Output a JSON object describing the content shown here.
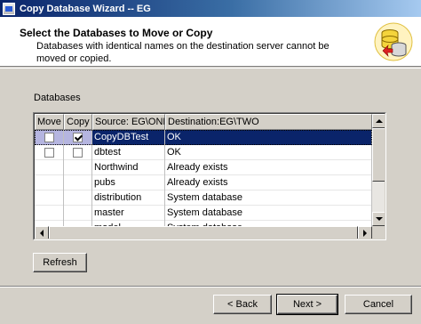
{
  "window": {
    "title": "Copy Database Wizard  -- EG"
  },
  "header": {
    "title": "Select the Databases to Move or Copy",
    "description": "Databases with identical names on the destination server cannot be moved or copied.",
    "icon": "database-copy-icon"
  },
  "databases_label": "Databases",
  "grid": {
    "columns": [
      "Move",
      "Copy",
      "Source: EG\\ONE",
      "Destination:EG\\TWO"
    ],
    "rows": [
      {
        "move": false,
        "copy": true,
        "source": "CopyDBTest",
        "destination": "OK",
        "selected": true,
        "has_checkboxes": true
      },
      {
        "move": false,
        "copy": false,
        "source": "dbtest",
        "destination": "OK",
        "selected": false,
        "has_checkboxes": true
      },
      {
        "source": "Northwind",
        "destination": "Already exists",
        "has_checkboxes": false
      },
      {
        "source": "pubs",
        "destination": "Already exists",
        "has_checkboxes": false
      },
      {
        "source": "distribution",
        "destination": "System database",
        "has_checkboxes": false
      },
      {
        "source": "master",
        "destination": "System database",
        "has_checkboxes": false
      },
      {
        "source": "model",
        "destination": "System database",
        "has_checkboxes": false
      }
    ]
  },
  "buttons": {
    "refresh": "Refresh",
    "back": "< Back",
    "next": "Next >",
    "cancel": "Cancel"
  },
  "colors": {
    "titlebar": "#0a246a",
    "selection": "#0a246a",
    "face": "#d4d0c8"
  }
}
